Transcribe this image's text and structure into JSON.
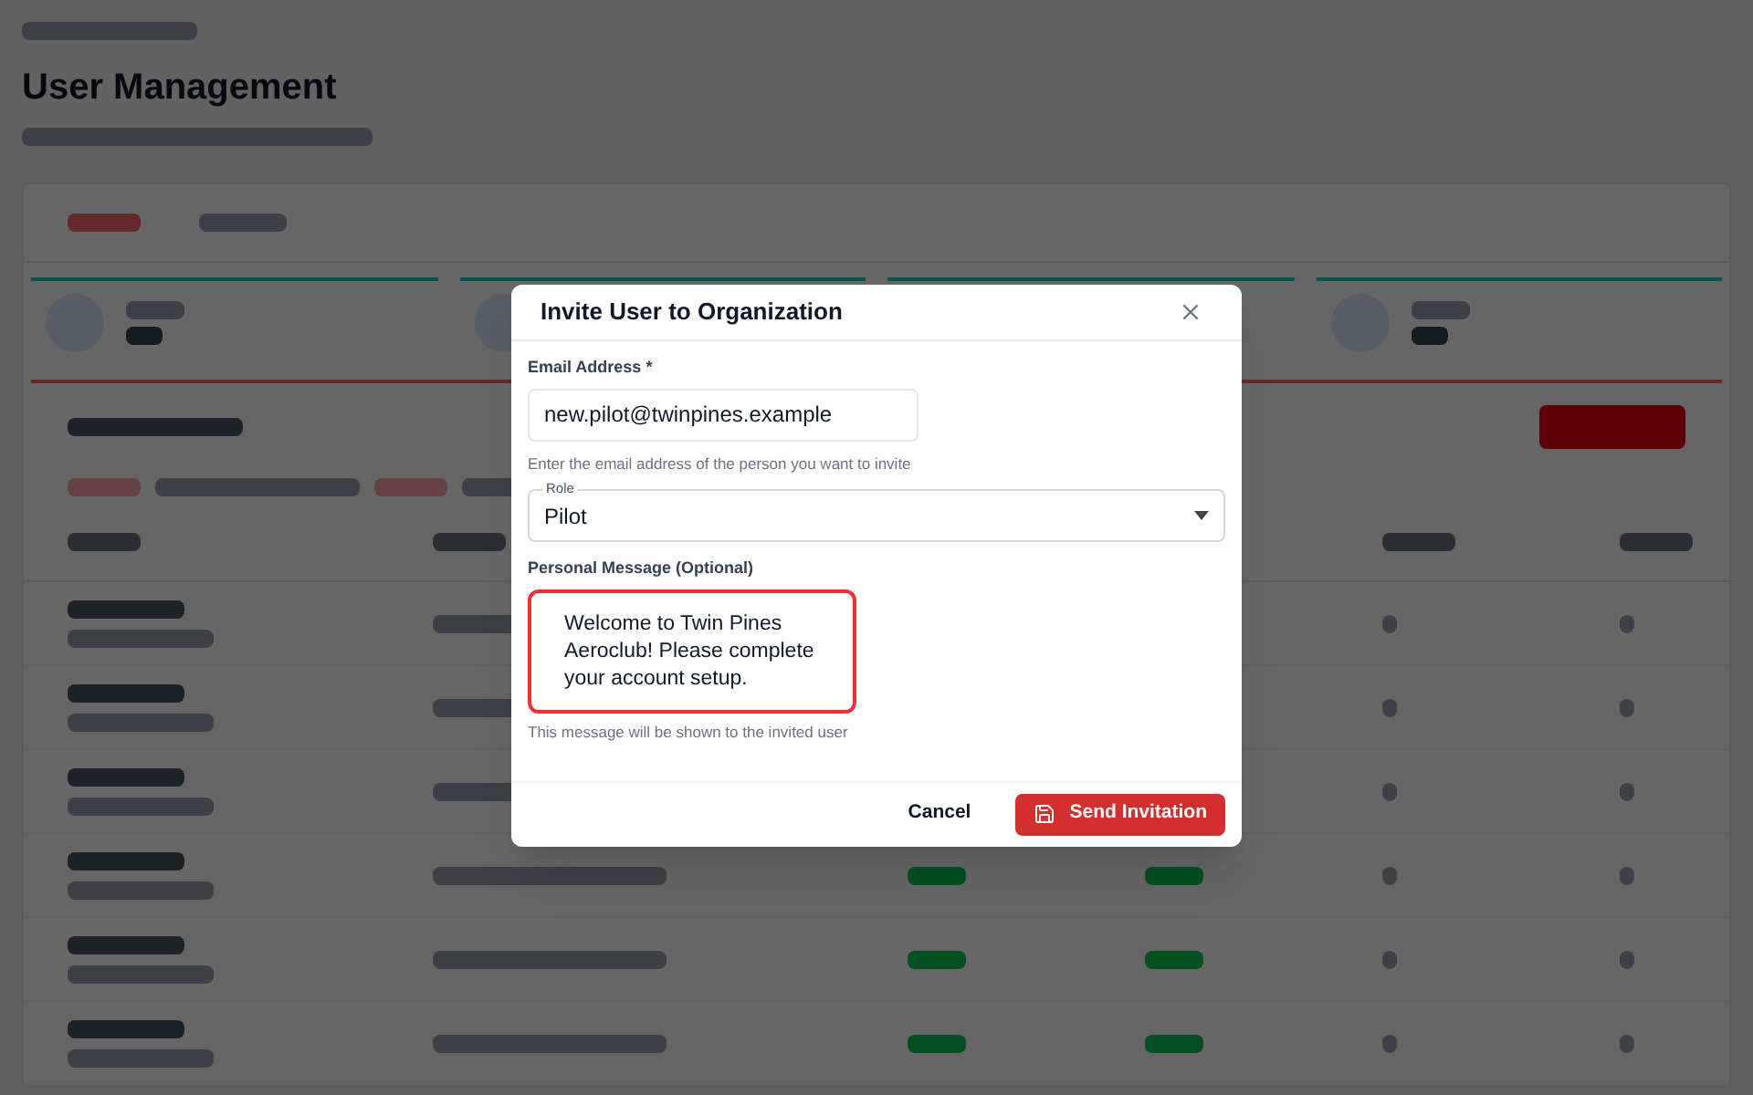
{
  "page": {
    "title": "User Management"
  },
  "dialog": {
    "title": "Invite User to Organization",
    "email": {
      "label": "Email Address *",
      "value": "new.pilot@twinpines.example",
      "hint": "Enter the email address of the person you want to invite"
    },
    "role": {
      "label": "Role",
      "value": "Pilot"
    },
    "message": {
      "label": "Personal Message (Optional)",
      "value": "Welcome to Twin Pines Aeroclub! Please complete your account setup.",
      "hint": "This message will be shown to the invited user",
      "error": true
    },
    "buttons": [
      {
        "kind": "text",
        "label": "Cancel"
      },
      {
        "kind": "primary",
        "label": "Send Invitation"
      }
    ]
  }
}
